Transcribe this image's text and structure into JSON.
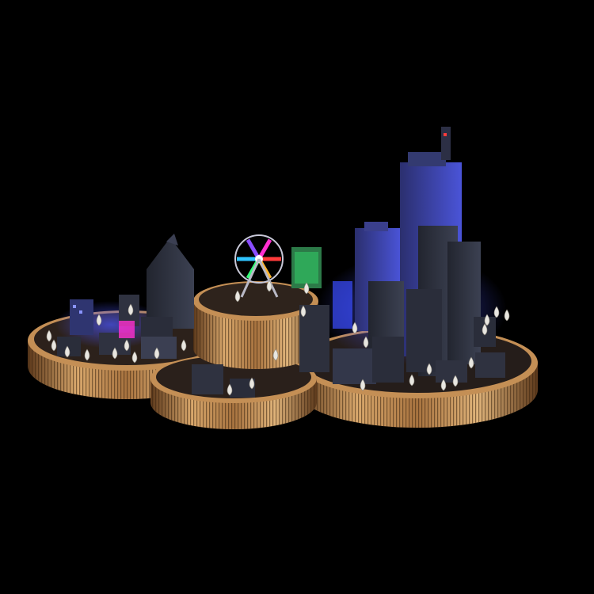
{
  "scene": {
    "subject": "coin-city",
    "colors": {
      "background": "#000000",
      "coin_gold_light": "#d9a86c",
      "coin_gold_mid": "#a8733f",
      "coin_gold_dark": "#5e3a1c",
      "coin_top": "#3a2a1e",
      "building_dark": "#2a2d3a",
      "building_mid": "#3b3f52",
      "neon_blue": "#3a4dff",
      "neon_magenta": "#ff2fd0",
      "neon_green": "#37ff7a",
      "tree_silver": "#e8e6e0"
    },
    "ferris_wheel_colors": [
      "#ff3b3b",
      "#ffb52e",
      "#37ff7a",
      "#2fc4ff",
      "#8a4dff",
      "#ff2fd0"
    ]
  }
}
